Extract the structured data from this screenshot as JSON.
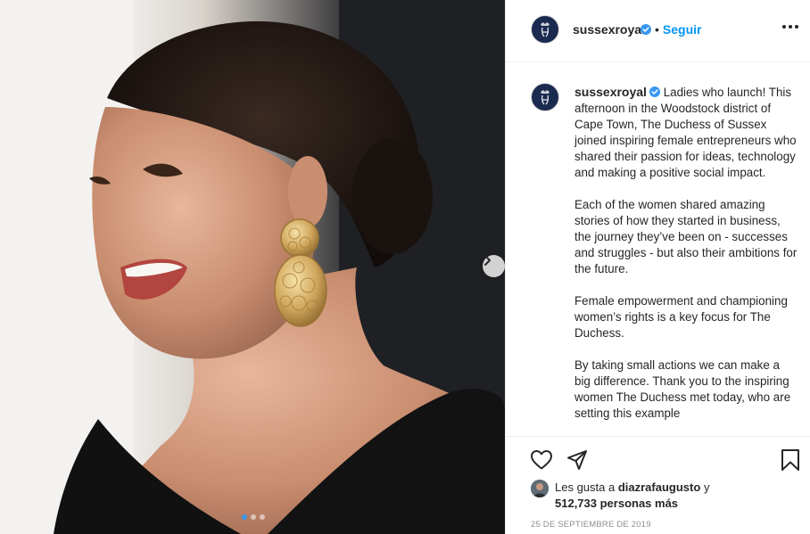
{
  "post": {
    "username": "sussexroyal",
    "follow_label": "Seguir",
    "separator": "•",
    "caption_paragraphs": [
      "Ladies who launch! This afternoon in the Woodstock district of Cape Town, The Duchess of Sussex joined inspiring female entrepreneurs who shared their passion for ideas, technology and making a positive social impact.",
      "Each of the women shared amazing stories of how they started in business, the journey they’ve been on - successes and struggles - but also their ambitions for the future.",
      "Female empowerment and championing women’s rights is a key focus for The Duchess.",
      "By taking small actions we can make a big difference. Thank you to the inspiring women The Duchess met today, who are setting this example"
    ],
    "likes": {
      "prefix": "Les gusta a",
      "user": "diazrafaugusto",
      "connector": "y",
      "count_text": "512,733 personas más"
    },
    "date": "25 DE SEPTIEMBRE DE 2019",
    "carousel": {
      "slides": 3,
      "active_index": 0
    }
  },
  "icons": {
    "verified": "verified-badge-icon",
    "more": "more-options-icon",
    "next": "chevron-right-icon",
    "like": "heart-icon",
    "share": "paper-plane-icon",
    "save": "bookmark-icon"
  },
  "colors": {
    "link": "#0095f6",
    "verified": "#3897f0",
    "text": "#262626",
    "muted": "#8e8e8e",
    "avatar": "#1b2a4f"
  }
}
